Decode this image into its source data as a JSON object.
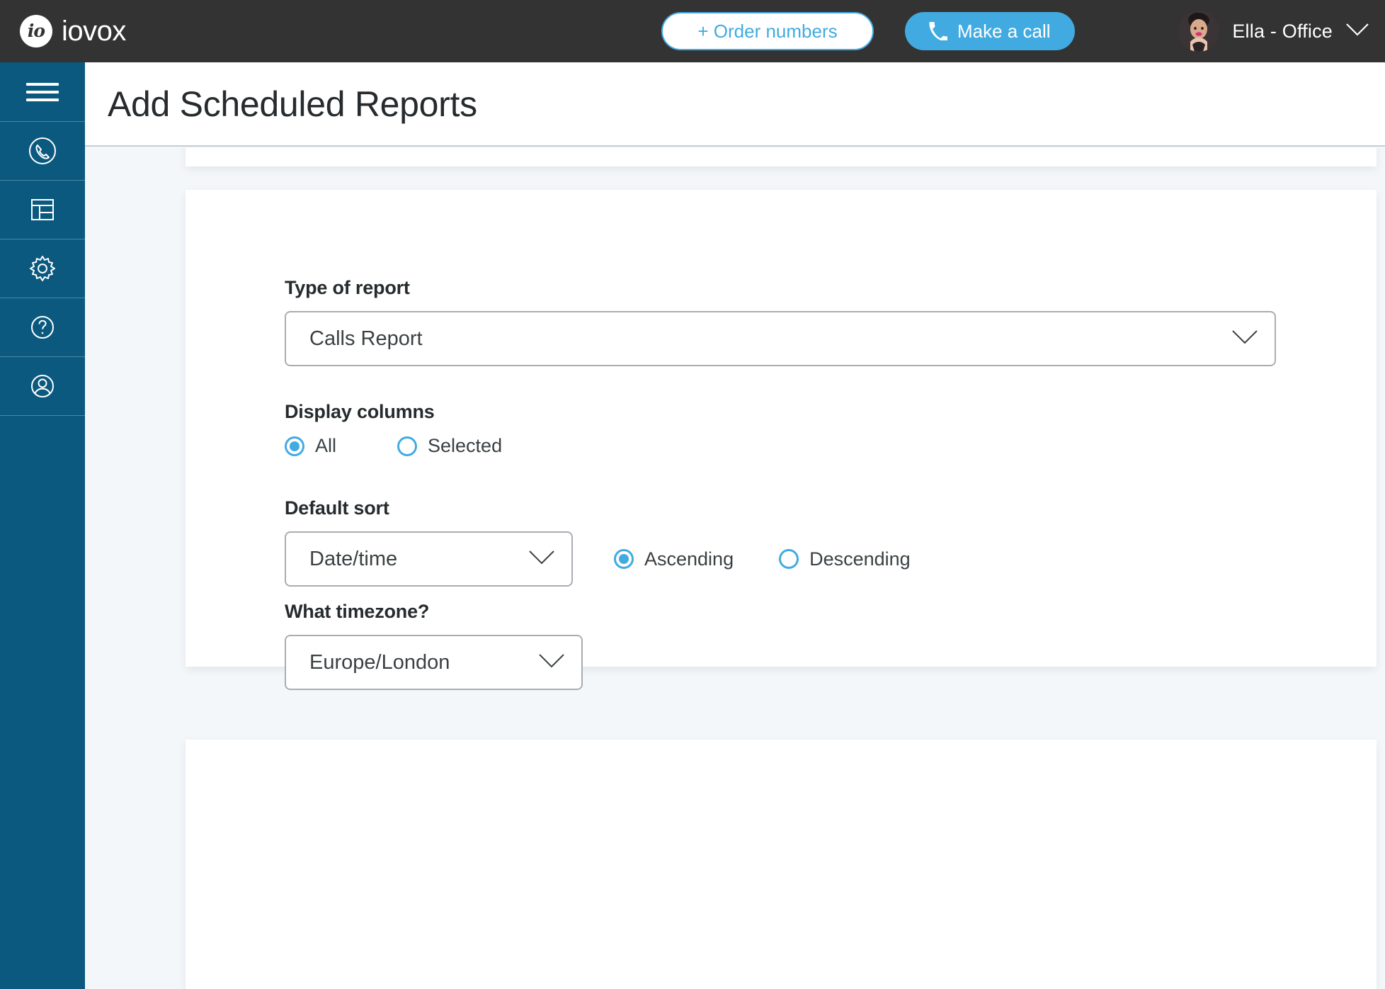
{
  "brand": {
    "logo_mark": "io",
    "logo_text": "iovox"
  },
  "topbar": {
    "order_numbers_label": "+ Order numbers",
    "make_call_label": "Make a call",
    "make_call_icon": "phone-icon",
    "user_name": "Ella - Office",
    "user_chevron_icon": "chevron-down-icon",
    "avatar_icon": "user-avatar"
  },
  "sidebar": {
    "items": [
      {
        "icon": "hamburger-menu-icon",
        "name": "menu"
      },
      {
        "icon": "phone-circle-icon",
        "name": "calls"
      },
      {
        "icon": "dashboard-layout-icon",
        "name": "reports"
      },
      {
        "icon": "gear-icon",
        "name": "settings"
      },
      {
        "icon": "question-circle-icon",
        "name": "help"
      },
      {
        "icon": "user-circle-icon",
        "name": "account"
      }
    ]
  },
  "page": {
    "title": "Add Scheduled Reports"
  },
  "form": {
    "type_of_report": {
      "label": "Type of report",
      "value": "Calls Report",
      "chevron_icon": "chevron-down-icon"
    },
    "display_columns": {
      "label": "Display columns",
      "options": [
        {
          "label": "All",
          "selected": true
        },
        {
          "label": "Selected",
          "selected": false
        }
      ]
    },
    "default_sort": {
      "label": "Default sort",
      "value": "Date/time",
      "chevron_icon": "chevron-down-icon",
      "direction_options": [
        {
          "label": "Ascending",
          "selected": true
        },
        {
          "label": "Descending",
          "selected": false
        }
      ]
    },
    "timezone": {
      "label": "What timezone?",
      "value": "Europe/London",
      "chevron_icon": "chevron-down-icon"
    }
  },
  "colors": {
    "accent_blue": "#41abe1",
    "sidebar_blue": "#0b597f",
    "topbar_dark": "#333333",
    "page_background": "#f3f7fa"
  }
}
